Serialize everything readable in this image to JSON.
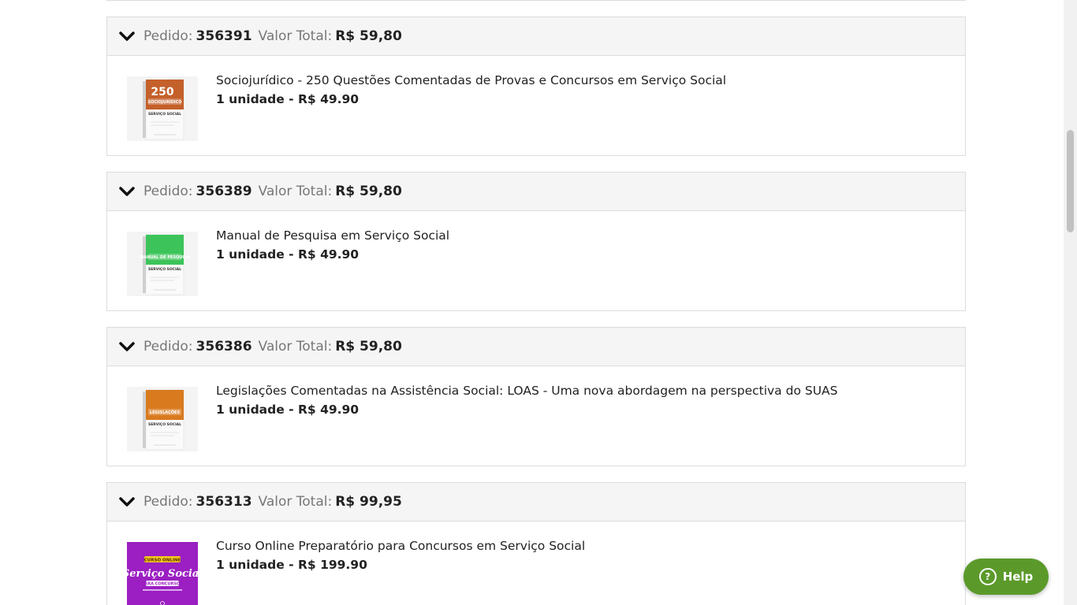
{
  "orders": [
    {
      "pedido_label": "Pedido:",
      "pedido_number": "356391",
      "total_label": "Valor Total:",
      "total_value": "R$ 59,80",
      "item": {
        "title": "Sociojurídico - 250 Questões Comentadas de Provas e Concursos em Serviço Social",
        "quantity": "1 unidade - R$ 49.90",
        "cover": {
          "icon": "book-cover-sociojuridico",
          "color": "#c4602a",
          "big_text": "250",
          "band_text": "SOCIOJURÍDICO",
          "sub_text": "SERVIÇO SOCIAL"
        }
      }
    },
    {
      "pedido_label": "Pedido:",
      "pedido_number": "356389",
      "total_label": "Valor Total:",
      "total_value": "R$ 59,80",
      "item": {
        "title": "Manual de Pesquisa em Serviço Social",
        "quantity": "1 unidade - R$ 49.90",
        "cover": {
          "icon": "book-cover-manual-pesquisa",
          "color": "#3cc45a",
          "band_text": "MANUAL DE PESQUISA",
          "sub_text": "SERVIÇO SOCIAL"
        }
      }
    },
    {
      "pedido_label": "Pedido:",
      "pedido_number": "356386",
      "total_label": "Valor Total:",
      "total_value": "R$ 59,80",
      "item": {
        "title": "Legislações Comentadas na Assistência Social: LOAS - Uma nova abordagem na perspectiva do SUAS",
        "quantity": "1 unidade - R$ 49.90",
        "cover": {
          "icon": "book-cover-legislacoes",
          "color": "#d97a1e",
          "band_text": "LEGISLAÇÕES",
          "sub_text": "SERVIÇO SOCIAL"
        }
      }
    },
    {
      "pedido_label": "Pedido:",
      "pedido_number": "356313",
      "total_label": "Valor Total:",
      "total_value": "R$ 99,95",
      "item": {
        "title": "Curso Online Preparatório para Concursos em Serviço Social",
        "quantity": "1 unidade - R$ 199.90",
        "cover": {
          "icon": "course-cover-servico-social",
          "color": "#9b1fc2",
          "tag_text": "CURSO ONLINE",
          "script_text": "Serviço Social",
          "band_text": "PARA CONCURSOS"
        }
      }
    }
  ],
  "help": {
    "label": "Help",
    "icon": "question-circle-icon",
    "color": "#5b9a2a"
  }
}
